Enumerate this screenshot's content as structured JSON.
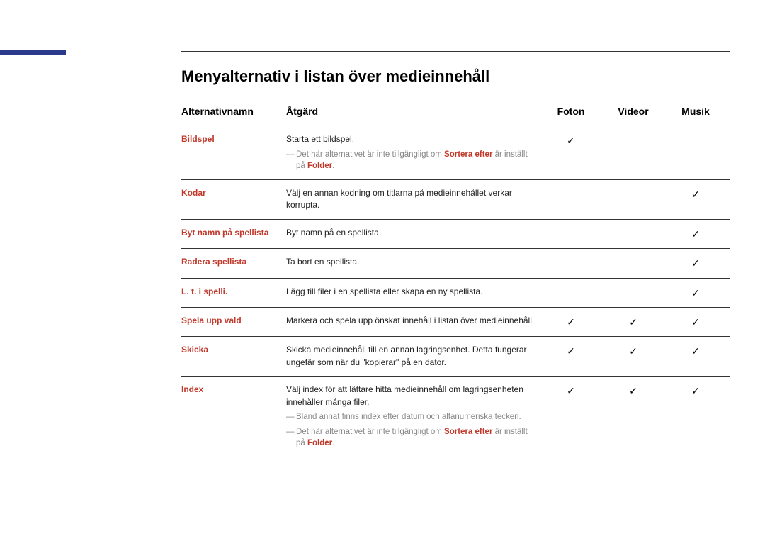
{
  "title": "Menyalternativ i listan över medieinnehåll",
  "headers": {
    "name": "Alternativnamn",
    "action": "Åtgärd",
    "foton": "Foton",
    "videor": "Videor",
    "musik": "Musik"
  },
  "check": "✓",
  "note_prefix": "Det här alternativet är inte tillgängligt om ",
  "note_sort_by": "Sortera efter",
  "note_middle": " är inställt på ",
  "note_folder": "Folder",
  "note_period": ".",
  "rows": [
    {
      "name": "Bildspel",
      "action": "Starta ett bildspel.",
      "foton": true,
      "videor": false,
      "musik": false,
      "notes": [
        "unavailable_folder"
      ]
    },
    {
      "name": "Kodar",
      "action": "Välj en annan kodning om titlarna på medieinnehållet verkar korrupta.",
      "foton": false,
      "videor": false,
      "musik": true
    },
    {
      "name": "Byt namn på spellista",
      "action": "Byt namn på en spellista.",
      "foton": false,
      "videor": false,
      "musik": true
    },
    {
      "name": "Radera spellista",
      "action": "Ta bort en spellista.",
      "foton": false,
      "videor": false,
      "musik": true
    },
    {
      "name": "L. t. i spelli.",
      "action": "Lägg till filer i en spellista eller skapa en ny spellista.",
      "foton": false,
      "videor": false,
      "musik": true
    },
    {
      "name": "Spela upp vald",
      "action": "Markera och spela upp önskat innehåll i listan över medieinnehåll.",
      "foton": true,
      "videor": true,
      "musik": true
    },
    {
      "name": "Skicka",
      "action": "Skicka medieinnehåll till en annan lagringsenhet. Detta fungerar ungefär som när du \"kopierar\" på en dator.",
      "foton": true,
      "videor": true,
      "musik": true
    },
    {
      "name": "Index",
      "action": "Välj index för att lättare hitta medieinnehåll om lagringsenheten innehåller många filer.",
      "foton": true,
      "videor": true,
      "musik": true,
      "notes": [
        "index_note",
        "unavailable_folder"
      ]
    }
  ],
  "index_note_text": "Bland annat finns index efter datum och alfanumeriska tecken."
}
